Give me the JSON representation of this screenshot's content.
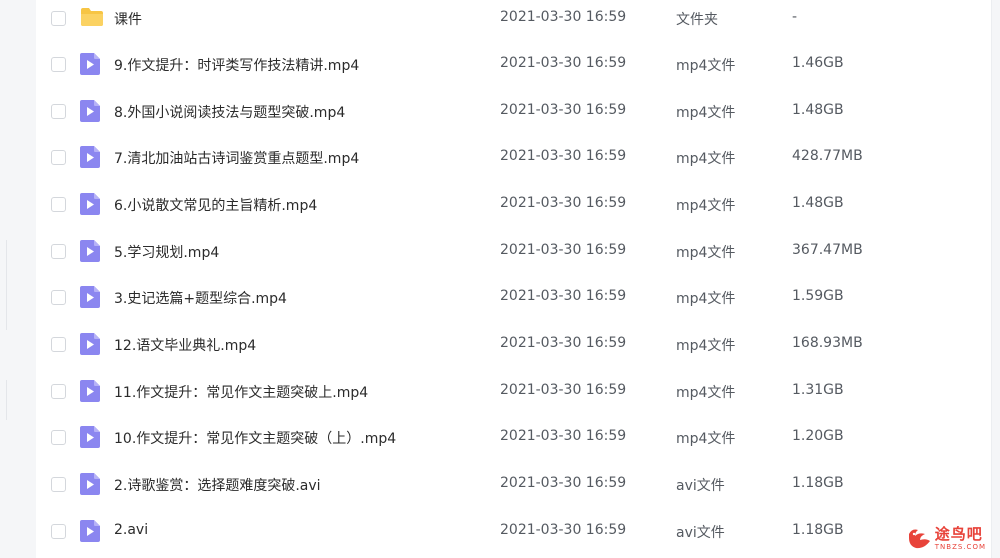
{
  "files": [
    {
      "name": "课件",
      "time": "2021-03-30 16:59",
      "type": "文件夹",
      "size": "-",
      "icon": "folder-icon"
    },
    {
      "name": "9.作文提升：时评类写作技法精讲.mp4",
      "time": "2021-03-30 16:59",
      "type": "mp4文件",
      "size": "1.46GB",
      "icon": "video-file-icon"
    },
    {
      "name": "8.外国小说阅读技法与题型突破.mp4",
      "time": "2021-03-30 16:59",
      "type": "mp4文件",
      "size": "1.48GB",
      "icon": "video-file-icon"
    },
    {
      "name": "7.清北加油站古诗词鉴赏重点题型.mp4",
      "time": "2021-03-30 16:59",
      "type": "mp4文件",
      "size": "428.77MB",
      "icon": "video-file-icon"
    },
    {
      "name": "6.小说散文常见的主旨精析.mp4",
      "time": "2021-03-30 16:59",
      "type": "mp4文件",
      "size": "1.48GB",
      "icon": "video-file-icon"
    },
    {
      "name": "5.学习规划.mp4",
      "time": "2021-03-30 16:59",
      "type": "mp4文件",
      "size": "367.47MB",
      "icon": "video-file-icon"
    },
    {
      "name": "3.史记选篇+题型综合.mp4",
      "time": "2021-03-30 16:59",
      "type": "mp4文件",
      "size": "1.59GB",
      "icon": "video-file-icon"
    },
    {
      "name": "12.语文毕业典礼.mp4",
      "time": "2021-03-30 16:59",
      "type": "mp4文件",
      "size": "168.93MB",
      "icon": "video-file-icon"
    },
    {
      "name": "11.作文提升：常见作文主题突破上.mp4",
      "time": "2021-03-30 16:59",
      "type": "mp4文件",
      "size": "1.31GB",
      "icon": "video-file-icon"
    },
    {
      "name": "10.作文提升：常见作文主题突破（上）.mp4",
      "time": "2021-03-30 16:59",
      "type": "mp4文件",
      "size": "1.20GB",
      "icon": "video-file-icon"
    },
    {
      "name": "2.诗歌鉴赏：选择题难度突破.avi",
      "time": "2021-03-30 16:59",
      "type": "avi文件",
      "size": "1.18GB",
      "icon": "video-file-icon"
    },
    {
      "name": "2.avi",
      "time": "2021-03-30 16:59",
      "type": "avi文件",
      "size": "1.18GB",
      "icon": "video-file-icon"
    }
  ],
  "watermark": {
    "cn": "途鸟吧",
    "en": "TNBZS.COM"
  },
  "colors": {
    "folder": "#f7c544",
    "video": "#8b86f0",
    "text": "#2b2b2b",
    "muted": "#555a61",
    "watermark": "#e8433a"
  }
}
